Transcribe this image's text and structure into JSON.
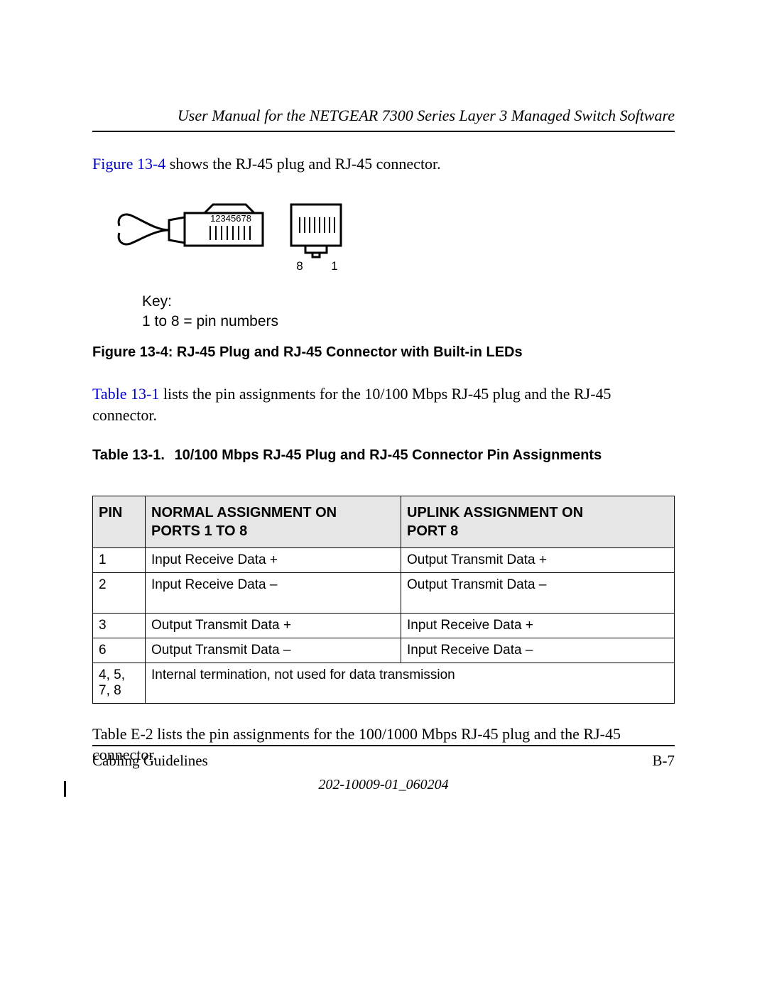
{
  "header": {
    "title": "User Manual for the NETGEAR 7300 Series Layer 3 Managed Switch Software"
  },
  "para1": {
    "xref": "Figure 13-4",
    "rest": " shows the RJ-45 plug and RJ-45 connector."
  },
  "diagram": {
    "plug_pins": "12345678",
    "connector_labels": {
      "left": "8",
      "right": "1"
    },
    "key_title": "Key:",
    "key_line": " 1 to 8 = pin numbers"
  },
  "figure_caption": "Figure 13-4:  RJ-45 Plug and RJ-45 Connector with Built-in LEDs",
  "para2": {
    "xref": "Table 13-1",
    "rest": " lists the pin assignments for the 10/100 Mbps RJ-45 plug and the RJ-45 connector."
  },
  "table_caption": {
    "num": "Table 13-1.",
    "title": "10/100 Mbps RJ-45 Plug and RJ-45 Connector Pin Assignments"
  },
  "table": {
    "headers": {
      "pin": "PIN",
      "normal_l1": "Normal Assignment on",
      "normal_l2": "Ports 1 to 8",
      "uplink_l1": "Uplink Assignment on",
      "uplink_l2": "Port 8"
    },
    "rows": [
      {
        "pin": "1",
        "normal": "Input Receive Data +",
        "uplink": "Output Transmit Data +"
      },
      {
        "pin": "2",
        "normal": "Input Receive Data –",
        "uplink": "Output Transmit Data –"
      },
      {
        "pin": "3",
        "normal": "Output Transmit Data +",
        "uplink": "Input Receive Data +"
      },
      {
        "pin": "6",
        "normal": "Output Transmit Data –",
        "uplink": "Input Receive Data –"
      }
    ],
    "span_row": {
      "pin": "4, 5, 7, 8",
      "text": "Internal termination, not used for data transmission"
    }
  },
  "para3": "Table E-2 lists the pin assignments for the 100/1000 Mbps RJ-45 plug and the RJ-45 connector.",
  "footer": {
    "section": "Cabling Guidelines",
    "page_number": "B-7",
    "doc_number": "202-10009-01_060204"
  }
}
